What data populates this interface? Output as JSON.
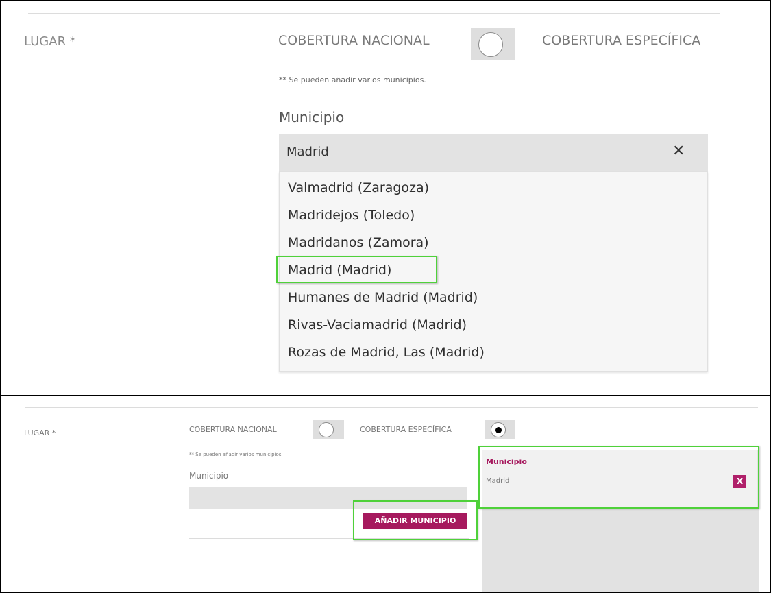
{
  "top": {
    "lugar_label": "LUGAR *",
    "cobertura_nacional": "COBERTURA NACIONAL",
    "cobertura_especifica": "COBERTURA ESPECÍFICA",
    "note": "** Se pueden añadir varios municipios.",
    "municipio_label": "Municipio",
    "input_value": "Madrid",
    "clear_glyph": "✕",
    "options": [
      "Valmadrid (Zaragoza)",
      "Madridejos (Toledo)",
      "Madridanos (Zamora)",
      "Madrid (Madrid)",
      "Humanes de Madrid (Madrid)",
      "Rivas-Vaciamadrid (Madrid)",
      "Rozas de Madrid, Las (Madrid)"
    ],
    "highlighted_option": "Madrid (Madrid)"
  },
  "bottom": {
    "lugar_label": "LUGAR *",
    "cobertura_nacional": "COBERTURA NACIONAL",
    "cobertura_especifica": "COBERTURA ESPECÍFICA",
    "especifica_selected": true,
    "note": "** Se pueden añadir varios municipios.",
    "municipio_label": "Municipio",
    "input_value": "",
    "add_button": "AÑADIR MUNICIPIO",
    "selected_panel": {
      "header": "Municipio",
      "items": [
        {
          "name": "Madrid",
          "remove": "X"
        }
      ]
    }
  },
  "colors": {
    "accent": "#a6195e",
    "highlight": "#4fd13a"
  }
}
